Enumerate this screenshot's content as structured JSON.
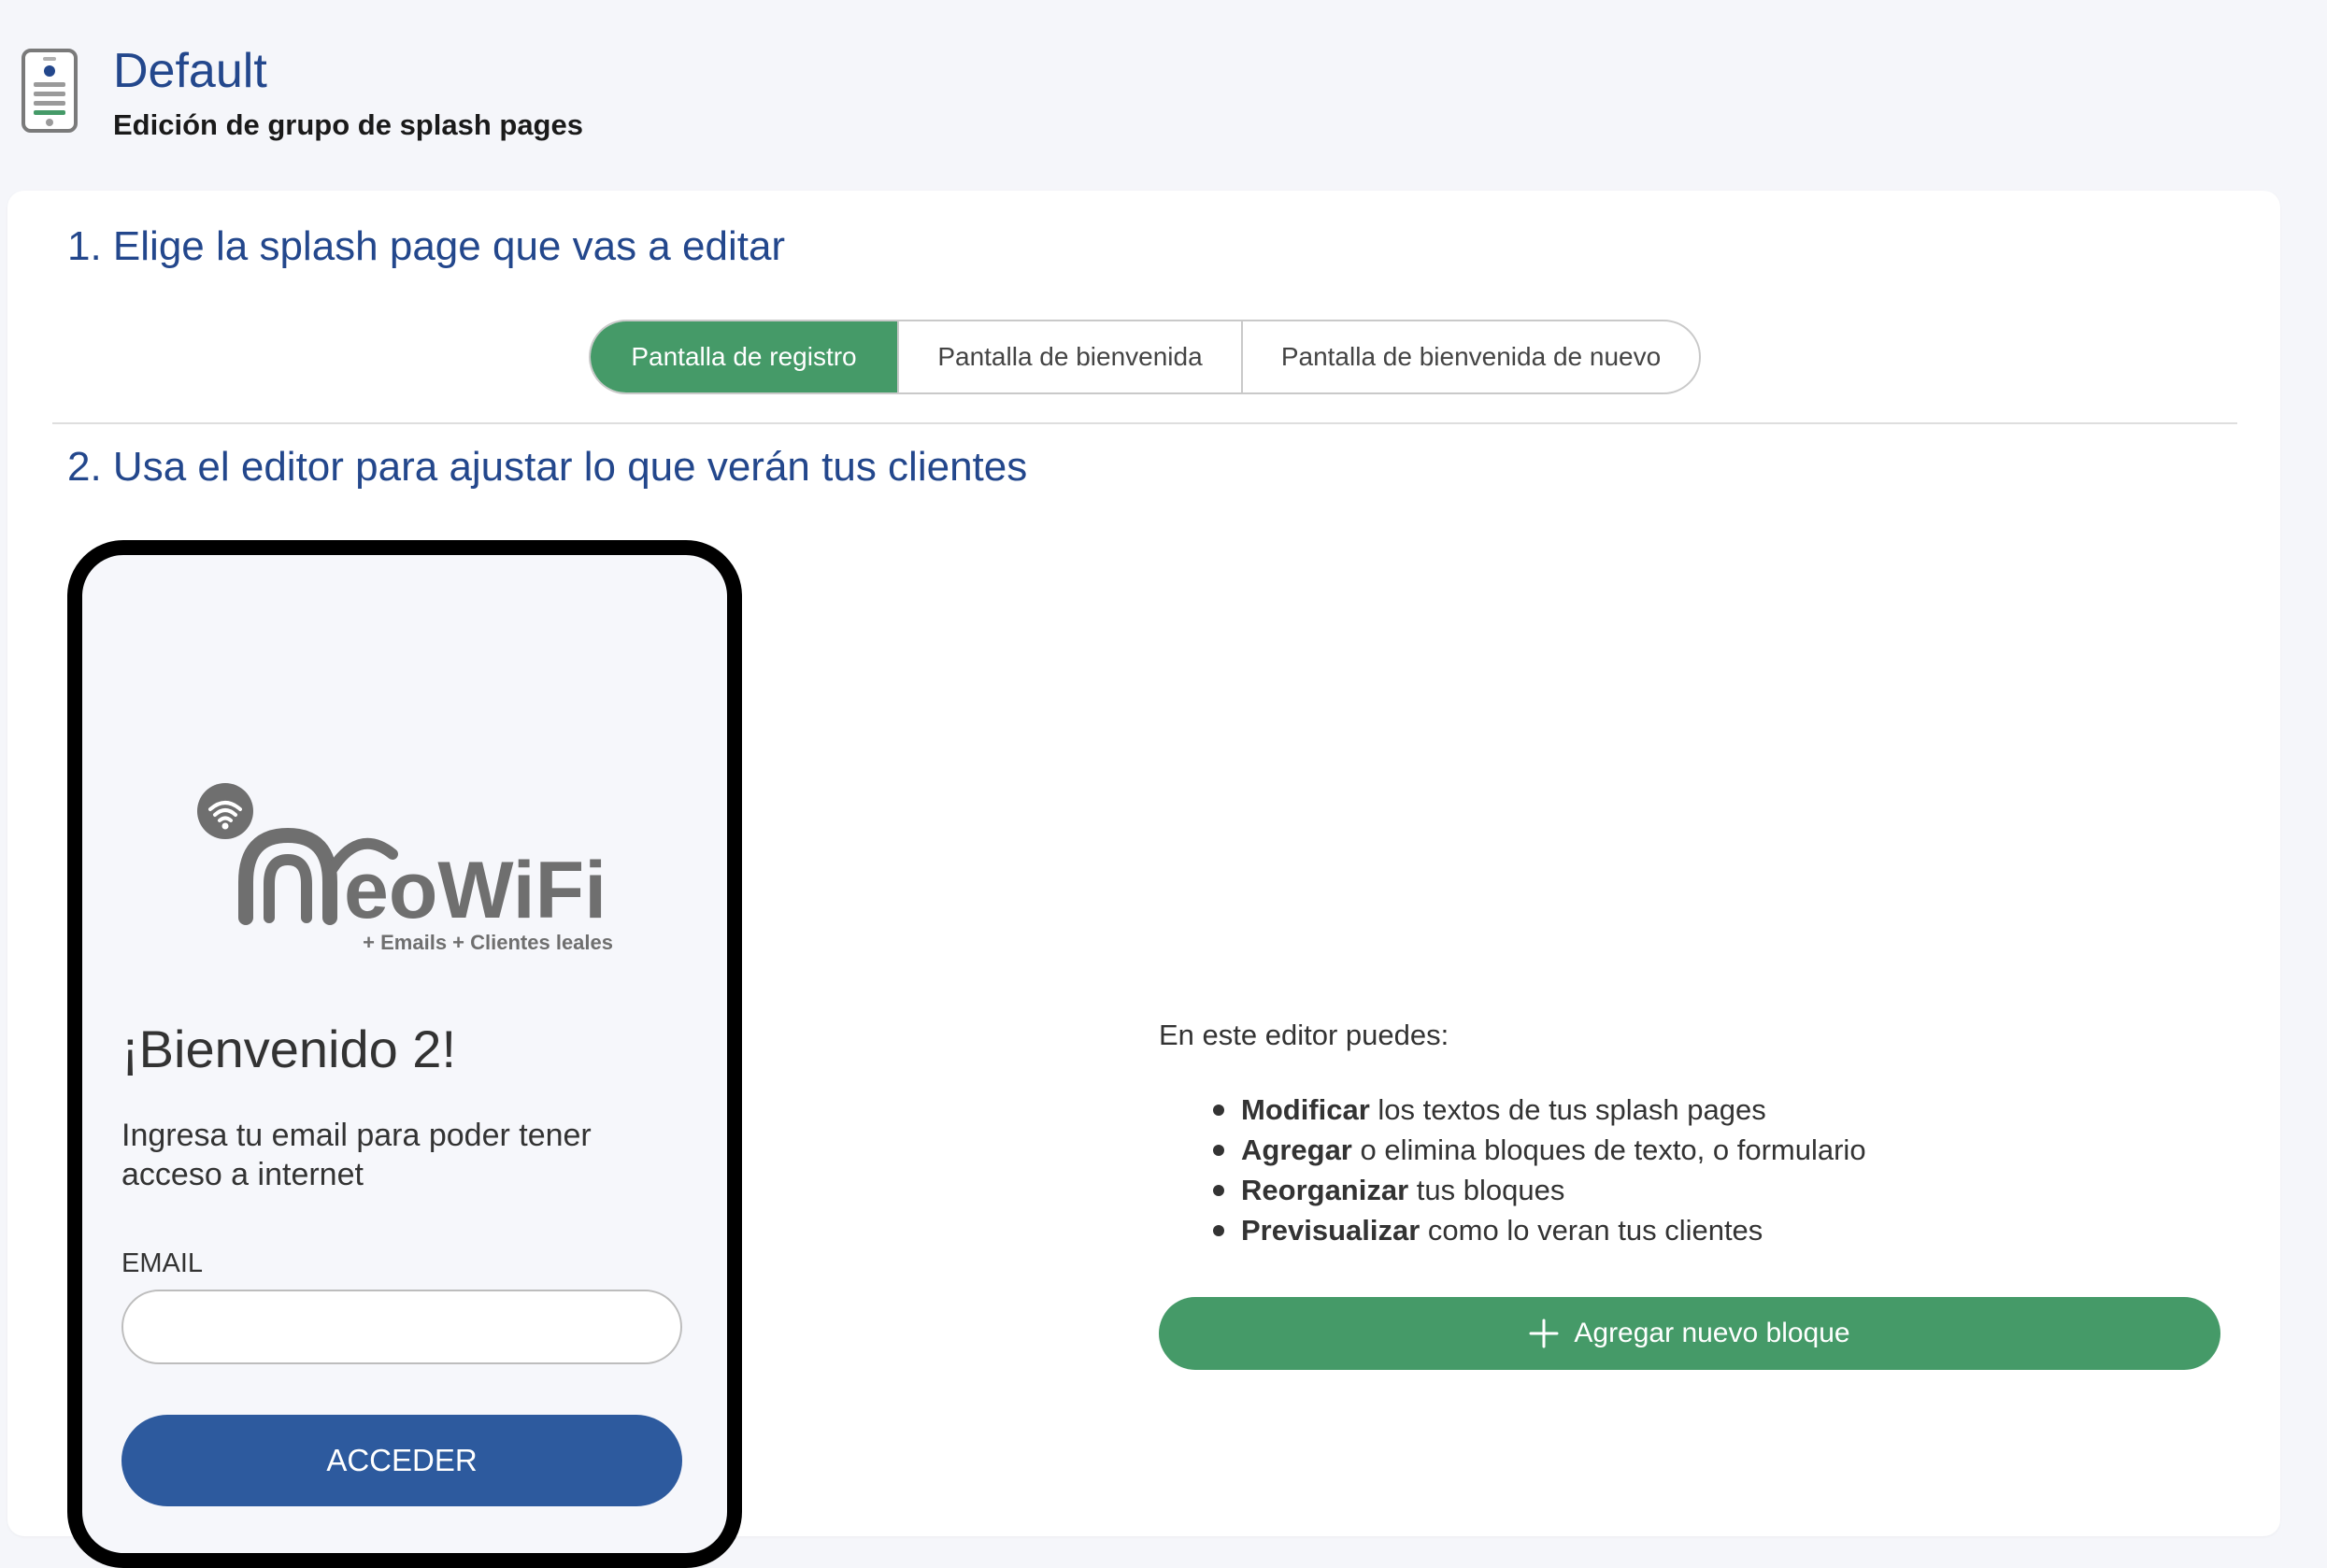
{
  "header": {
    "title": "Default",
    "subtitle": "Edición de grupo de splash pages"
  },
  "step1": {
    "heading": "1. Elige la splash page que vas a editar",
    "tabs": [
      {
        "label": "Pantalla de registro",
        "active": true
      },
      {
        "label": "Pantalla de bienvenida",
        "active": false
      },
      {
        "label": "Pantalla de bienvenida de nuevo",
        "active": false
      }
    ]
  },
  "step2": {
    "heading": "2. Usa el editor para ajustar lo que verán tus clientes"
  },
  "preview": {
    "logo_text": "eoWiFi",
    "logo_tagline": "+ Emails + Clientes leales",
    "welcome": "¡Bienvenido 2!",
    "instructions": "Ingresa tu email para poder tener acceso a internet",
    "email_label": "EMAIL",
    "email_value": "",
    "access_button": "ACCEDER"
  },
  "editor_info": {
    "intro": "En este editor puedes:",
    "items": [
      {
        "bold": "Modificar",
        "rest": " los textos de tus splash pages"
      },
      {
        "bold": "Agregar",
        "rest": " o elimina bloques de texto, o formulario"
      },
      {
        "bold": "Reorganizar",
        "rest": " tus bloques"
      },
      {
        "bold": "Previsualizar",
        "rest": " como lo veran tus clientes"
      }
    ],
    "add_button": "Agregar nuevo bloque"
  },
  "colors": {
    "title_blue": "#23478c",
    "green": "#459a68",
    "button_blue": "#2d5a9e",
    "logo_gray": "#6f6f6f"
  }
}
